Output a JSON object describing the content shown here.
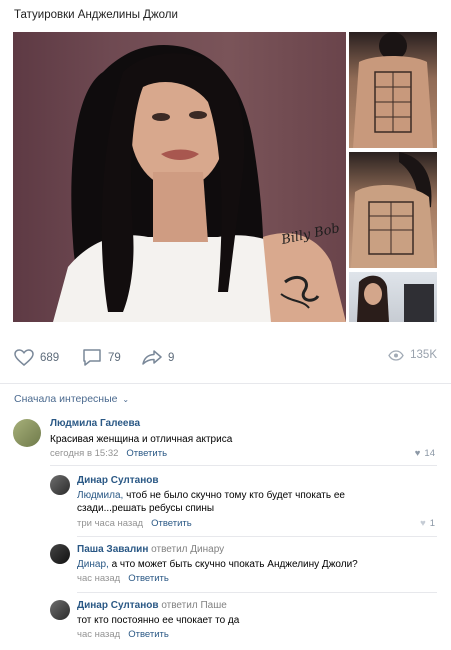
{
  "post": {
    "title": "Татуировки Анджелины Джоли"
  },
  "photos": {
    "tattoo_text": "Billy Bob"
  },
  "actions": {
    "likes": "689",
    "comments": "79",
    "shares": "9",
    "views": "135K"
  },
  "sort": {
    "label": "Сначала интересные"
  },
  "comments": [
    {
      "author": "Людмила Галеева",
      "reply_to": "",
      "address": "",
      "text": "Красивая женщина и отличная актриса",
      "time": "сегодня в 15:32",
      "reply_label": "Ответить",
      "likes": "14"
    },
    {
      "author": "Динар Султанов",
      "reply_to": "",
      "address": "Людмила,",
      "text": " чтоб не было скучно тому кто будет чпокать ее сзади...решать ребусы спины",
      "time": "три часа назад",
      "reply_label": "Ответить",
      "likes": "1"
    },
    {
      "author": "Паша Завалин",
      "reply_to": "ответил Динару",
      "address": "Динар,",
      "text": " а что может быть скучно чпокать Анджелину Джоли?",
      "time": "час назад",
      "reply_label": "Ответить",
      "likes": ""
    },
    {
      "author": "Динар Султанов",
      "reply_to": "ответил Паше",
      "address": "",
      "text": "тот кто постоянно ее чпокает то да",
      "time": "час назад",
      "reply_label": "Ответить",
      "likes": ""
    }
  ],
  "colors": {
    "link": "#2a5885",
    "meta": "#939393",
    "icon": "#7a8899"
  }
}
